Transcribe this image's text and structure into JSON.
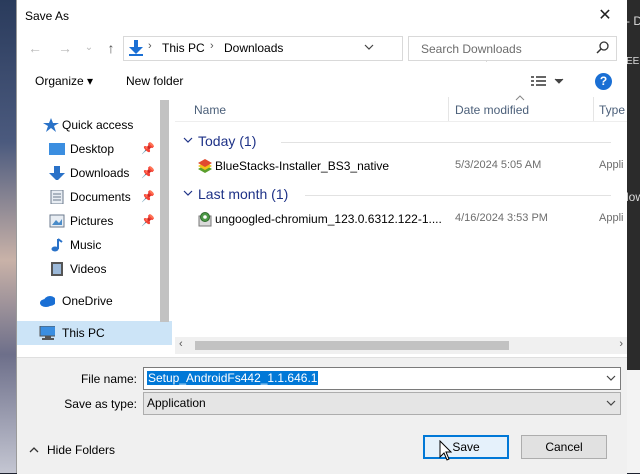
{
  "dialog": {
    "title": "Save As",
    "close": "✕"
  },
  "address": {
    "crumbs": [
      "This PC",
      "Downloads"
    ],
    "search_placeholder": "Search Downloads"
  },
  "toolbar": {
    "organize": "Organize ▾",
    "new_folder": "New folder",
    "help": "?"
  },
  "nav": {
    "items": [
      {
        "label": "Quick access",
        "icon": "star-icon"
      },
      {
        "label": "Desktop",
        "icon": "desktop-icon",
        "pinned": true
      },
      {
        "label": "Downloads",
        "icon": "download-arrow-icon",
        "pinned": true
      },
      {
        "label": "Documents",
        "icon": "documents-icon",
        "pinned": true
      },
      {
        "label": "Pictures",
        "icon": "pictures-icon",
        "pinned": true
      },
      {
        "label": "Music",
        "icon": "music-note-icon"
      },
      {
        "label": "Videos",
        "icon": "video-film-icon"
      },
      {
        "label": "OneDrive",
        "icon": "cloud-icon"
      },
      {
        "label": "This PC",
        "icon": "monitor-icon",
        "selected": true
      }
    ]
  },
  "columns": {
    "name": "Name",
    "date": "Date modified",
    "type": "Type"
  },
  "groups": [
    {
      "label": "Today (1)",
      "files": [
        {
          "name": "BlueStacks-Installer_BS3_native",
          "date": "5/3/2024 5:05 AM",
          "type": "Appli"
        }
      ]
    },
    {
      "label": "Last month (1)",
      "files": [
        {
          "name": "ungoogled-chromium_123.0.6312.122-1....",
          "date": "4/16/2024 3:53 PM",
          "type": "Appli"
        }
      ]
    }
  ],
  "form": {
    "file_name_label": "File name:",
    "file_name_value": "Setup_AndroidFs442_1.1.646.1",
    "save_as_type_label": "Save as type:",
    "save_as_type_value": "Application"
  },
  "buttons": {
    "hide_folders": "Hide Folders",
    "save": "Save",
    "cancel": "Cancel"
  },
  "background": {
    "right_text_top": "- D",
    "right_text_mid": "EEB",
    "right_text_low": "low"
  },
  "colors": {
    "accent": "#0078d7",
    "group_header": "#1e3287",
    "selected_nav": "#cce4f7",
    "help_blue": "#1a6fd4"
  }
}
